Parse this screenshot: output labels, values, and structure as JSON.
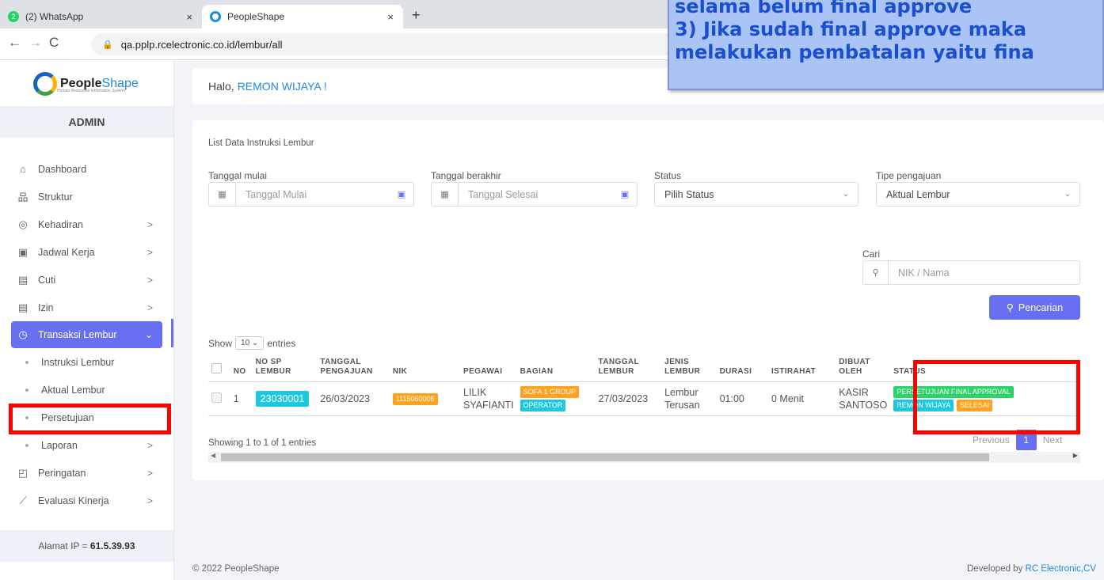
{
  "browser": {
    "tabs": [
      {
        "title": "(2) WhatsApp",
        "badge": "2",
        "close": "×"
      },
      {
        "title": "PeopleShape",
        "close": "×"
      }
    ],
    "new_tab": "+",
    "url": "qa.pplp.rcelectronic.co.id/lembur/all"
  },
  "sidebar": {
    "logo_main": "People",
    "logo_accent": "Shape",
    "logo_sub": "Human Resources Information System",
    "role": "ADMIN",
    "items": [
      {
        "label": "Dashboard",
        "icon": "home-icon"
      },
      {
        "label": "Struktur",
        "icon": "org-chart-icon"
      },
      {
        "label": "Kehadiran",
        "icon": "fingerprint-icon",
        "chevron": ">"
      },
      {
        "label": "Jadwal Kerja",
        "icon": "briefcase-icon",
        "chevron": ">"
      },
      {
        "label": "Cuti",
        "icon": "calendar-icon",
        "chevron": ">"
      },
      {
        "label": "Izin",
        "icon": "calendar-icon",
        "chevron": ">"
      },
      {
        "label": "Transaksi Lembur",
        "icon": "clock-icon",
        "chevron": "⌄"
      },
      {
        "label": "Instruksi Lembur"
      },
      {
        "label": "Aktual Lembur"
      },
      {
        "label": "Persetujuan"
      },
      {
        "label": "Laporan",
        "chevron": ">"
      },
      {
        "label": "Peringatan",
        "icon": "note-icon",
        "chevron": ">"
      },
      {
        "label": "Evaluasi Kinerja",
        "icon": "chart-line-icon",
        "chevron": ">"
      }
    ],
    "ip_label": "Alamat IP  =",
    "ip_value": "61.5.39.93"
  },
  "header": {
    "greeting": "Halo,",
    "user": "REMON WIJAYA !"
  },
  "card": {
    "title": "List Data Instruksi Lembur",
    "filters": {
      "start_label": "Tanggal mulai",
      "start_placeholder": "Tanggal Mulai",
      "end_label": "Tanggal berakhir",
      "end_placeholder": "Tanggal Selesai",
      "status_label": "Status",
      "status_value": "Pilih Status",
      "type_label": "Tipe pengajuan",
      "type_value": "Aktual Lembur",
      "search_label": "Cari",
      "search_placeholder": "NIK / Nama",
      "search_button": "Pencarian"
    },
    "show_label": "Show",
    "show_value": "10",
    "entries_label": "entries",
    "columns": [
      "NO",
      "NO SP LEMBUR",
      "TANGGAL PENGAJUAN",
      "NIK",
      "PEGAWAI",
      "BAGIAN",
      "TANGGAL LEMBUR",
      "JENIS LEMBUR",
      "DURASI",
      "ISTIRAHAT",
      "DIBUAT OLEH",
      "STATUS"
    ],
    "rows": [
      {
        "no": "1",
        "sp": "23030001",
        "tgl_pengajuan": "26/03/2023",
        "nik": "1115060006",
        "pegawai": "LILIK SYAFIANTI",
        "bagian1": "SOFA 1 GROUP",
        "bagian2": "OPERATOR",
        "tgl_lembur": "27/03/2023",
        "jenis": "Lembur Terusan",
        "durasi": "01:00",
        "istirahat": "0 Menit",
        "dibuat": "KASIR SANTOSO",
        "status1": "PERSETUJUAN FINAL APPROVAL",
        "status2": "REMON WIJAYA",
        "status3": "SELESAI"
      }
    ],
    "showing": "Showing 1 to 1 of 1 entries",
    "pager": {
      "prev": "Previous",
      "page": "1",
      "next": "Next"
    }
  },
  "footer": {
    "copyright": "© 2022 PeopleShape",
    "dev_label": "Developed by",
    "dev_name": "RC Electronic,CV"
  },
  "overlay": {
    "lines": [
      "selama belum final approve",
      "3) Jika sudah final approve maka",
      "melakukan pembatalan yaitu fina"
    ]
  },
  "colors": {
    "accent": "#6670f0",
    "annotation_red": "#ff0000"
  }
}
